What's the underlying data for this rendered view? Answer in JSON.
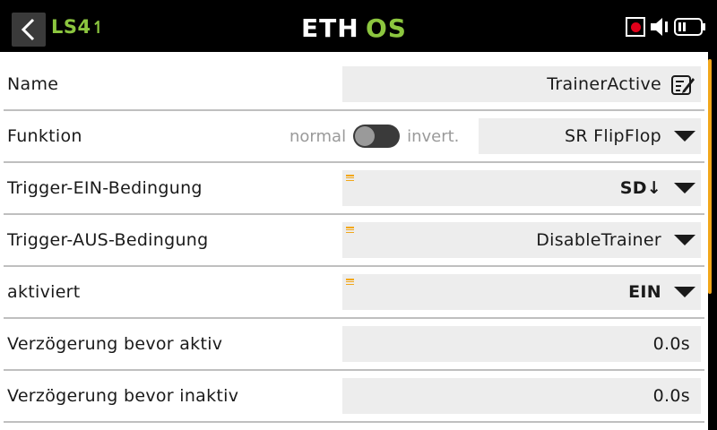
{
  "header": {
    "title": "LS4",
    "title_arrow": "↿",
    "logo_text": "ETHOS",
    "back_icon": "chevron-left-icon",
    "status_icons": [
      "record-icon",
      "speaker-icon",
      "battery-icon"
    ]
  },
  "rows": {
    "name": {
      "label": "Name",
      "value": "TrainerActive",
      "edit_icon": "edit-icon"
    },
    "funktion": {
      "label": "Funktion",
      "toggle_left": "normal",
      "toggle_right": "invert.",
      "value": "SR FlipFlop"
    },
    "trigger_ein": {
      "label": "Trigger-EIN-Bedingung",
      "value": "SD↓"
    },
    "trigger_aus": {
      "label": "Trigger-AUS-Bedingung",
      "value": "DisableTrainer"
    },
    "aktiviert": {
      "label": "aktiviert",
      "value": "EIN"
    },
    "verz_aktiv": {
      "label": "Verzögerung bevor aktiv",
      "value": "0.0s"
    },
    "verz_inaktiv": {
      "label": "Verzögerung bevor inaktiv",
      "value": "0.0s"
    }
  },
  "colors": {
    "accent_green": "#8cc63f",
    "accent_orange": "#f2a71b",
    "record_red": "#e0001a"
  }
}
